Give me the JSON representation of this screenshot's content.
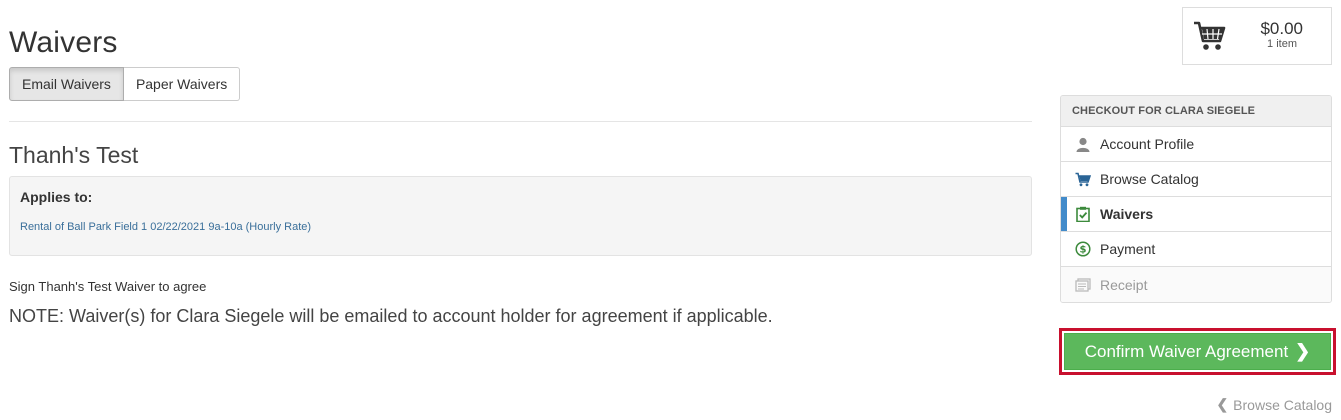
{
  "page": {
    "title": "Waivers"
  },
  "tabs": [
    {
      "label": "Email Waivers"
    },
    {
      "label": "Paper Waivers"
    }
  ],
  "waiver": {
    "title": "Thanh's Test",
    "applies_label": "Applies to:",
    "applies_link": "Rental of Ball Park Field 1 02/22/2021 9a-10a (Hourly Rate)",
    "sign_text": "Sign Thanh's Test Waiver to agree",
    "note": "NOTE: Waiver(s) for Clara Siegele will be emailed to account holder for agreement if applicable."
  },
  "cart": {
    "total": "$0.00",
    "count": "1 item"
  },
  "sidebar": {
    "header": "CHECKOUT FOR CLARA SIEGELE",
    "items": [
      {
        "label": "Account Profile",
        "icon": "user-icon"
      },
      {
        "label": "Browse Catalog",
        "icon": "cart-icon"
      },
      {
        "label": "Waivers",
        "icon": "clipboard-check-icon"
      },
      {
        "label": "Payment",
        "icon": "dollar-circle-icon"
      },
      {
        "label": "Receipt",
        "icon": "receipt-icon"
      }
    ]
  },
  "actions": {
    "confirm_label": "Confirm Waiver Agreement",
    "back_label": "Browse Catalog"
  },
  "colors": {
    "accent": "#428bca",
    "success": "#5cb85c",
    "highlight": "#c8102e"
  }
}
